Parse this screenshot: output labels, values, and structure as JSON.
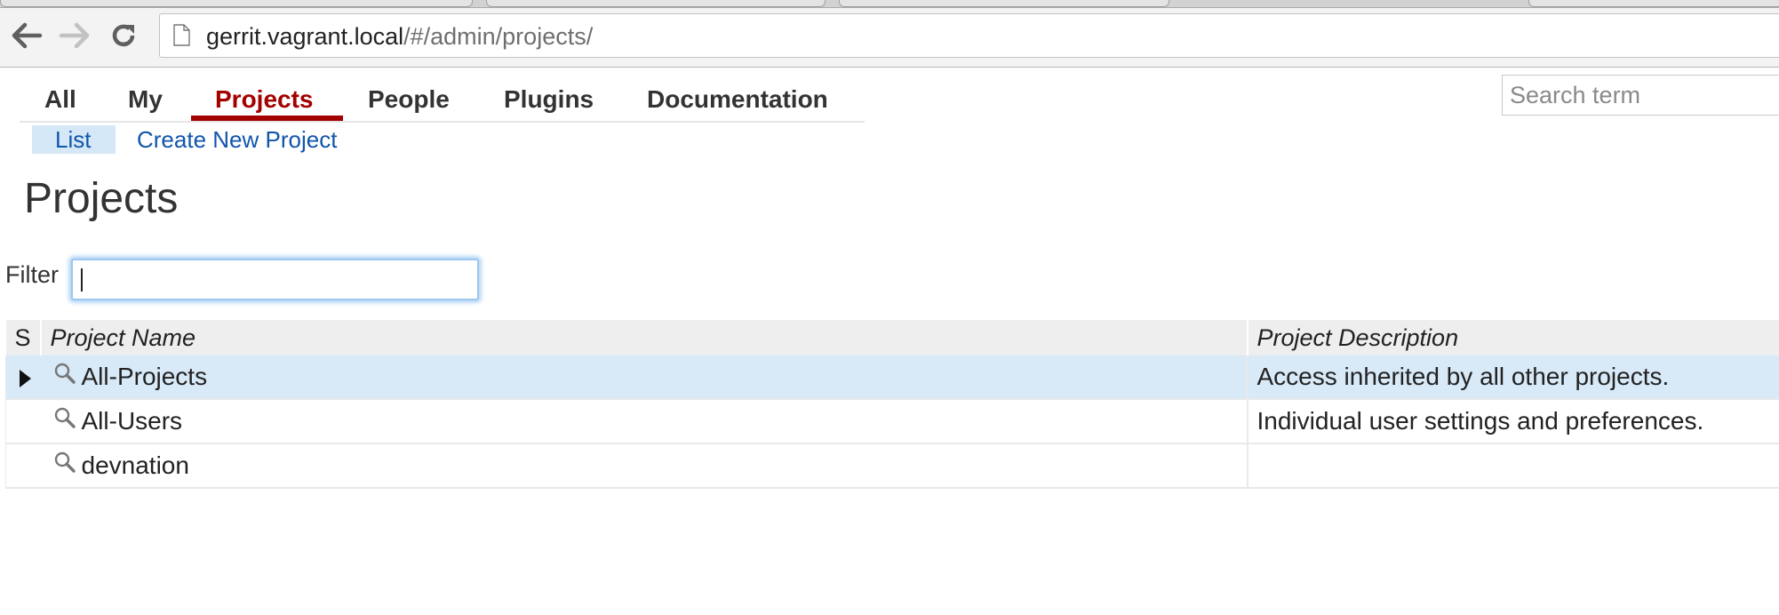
{
  "browser": {
    "url_host": "gerrit.vagrant.local",
    "url_path": "/#/admin/projects/"
  },
  "topmenu": {
    "items": [
      "All",
      "My",
      "Projects",
      "People",
      "Plugins",
      "Documentation"
    ],
    "active": "Projects"
  },
  "search": {
    "placeholder": "Search term"
  },
  "submenu": {
    "list_label": "List",
    "create_label": "Create New Project"
  },
  "page": {
    "title": "Projects"
  },
  "filter": {
    "label": "Filter",
    "value": ""
  },
  "table": {
    "headers": {
      "status": "S",
      "name": "Project Name",
      "description": "Project Description"
    },
    "rows": [
      {
        "name": "All-Projects",
        "description": "Access inherited by all other projects.",
        "selected": true
      },
      {
        "name": "All-Users",
        "description": "Individual user settings and preferences.",
        "selected": false
      },
      {
        "name": "devnation",
        "description": "",
        "selected": false
      }
    ]
  },
  "colors": {
    "accent_active": "#a30000",
    "link": "#1155aa",
    "selection": "#d8e9f7"
  },
  "icons": [
    "back-arrow-icon",
    "forward-arrow-icon",
    "reload-icon",
    "page-icon",
    "magnifier-icon",
    "row-pointer-icon"
  ]
}
